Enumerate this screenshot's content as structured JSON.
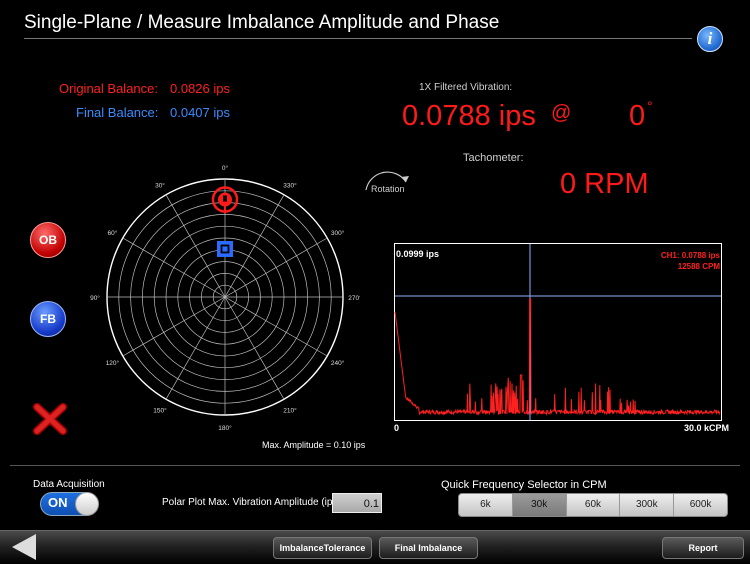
{
  "header": {
    "title": "Single-Plane / Measure Imbalance Amplitude and Phase",
    "info_icon": "info-icon"
  },
  "balance": {
    "original_label": "Original Balance:",
    "original_value": "0.0826 ips",
    "final_label": "Final Balance:",
    "final_value": "0.0407 ips"
  },
  "vibration": {
    "label": "1X Filtered Vibration:",
    "value": "0.0788 ips",
    "at": "@",
    "phase": "0",
    "phase_unit": "°"
  },
  "tachometer": {
    "label": "Tachometer:",
    "value": "0 RPM"
  },
  "rotation": {
    "label": "Rotation"
  },
  "side_buttons": {
    "ob": "OB",
    "fb": "FB"
  },
  "polar": {
    "angle_labels": [
      "0°",
      "30°",
      "60°",
      "90°",
      "120°",
      "150°",
      "180°",
      "210°",
      "240°",
      "270°",
      "300°",
      "330°"
    ],
    "max_amplitude": "Max. Amplitude = 0.10 ips",
    "scale_max": 0.1,
    "markers": [
      {
        "name": "original-balance-marker",
        "amplitude": 0.0826,
        "angle_deg": 0,
        "color": "#ff1a1a"
      },
      {
        "name": "final-balance-marker",
        "amplitude": 0.0407,
        "angle_deg": 0,
        "color": "#2a6cff"
      }
    ]
  },
  "spectrum": {
    "peak_label": "0.0999 ips",
    "channel_line1": "CH1: 0.0788 ips",
    "channel_line2": "12588 CPM",
    "x_start": "0",
    "x_end": "30.0 kCPM"
  },
  "controls": {
    "daq_label": "Data Acquisition",
    "daq_state": "ON",
    "polar_max_label": "Polar Plot Max. Vibration Amplitude (ips):",
    "polar_max_value": "0.1",
    "quick_freq_label": "Quick Frequency Selector in CPM",
    "freq_options": [
      "6k",
      "30k",
      "60k",
      "300k",
      "600k"
    ],
    "freq_selected": "30k"
  },
  "toolbar": {
    "imbalance_tolerance": "ImbalanceTolerance",
    "final_imbalance": "Final Imbalance",
    "report": "Report"
  }
}
